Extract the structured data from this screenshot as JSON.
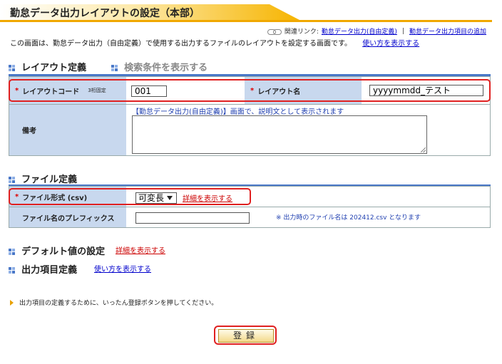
{
  "page": {
    "title": "勤怠データ出力レイアウトの設定（本部）",
    "related_label": "関連リンク:",
    "related_link_1": "勤怠データ出力(自由定義)",
    "separator": "|",
    "related_link_2": "勤怠データ出力項目の追加",
    "intro": "この画面は、勤怠データ出力（自由定義）で使用する出力するファイルのレイアウトを設定する画面です。",
    "howto_link": "使い方を表示する"
  },
  "layout_section": {
    "heading": "レイアウト定義",
    "toggle_search": "検索条件を表示する",
    "required_mark": "*",
    "code_label": "レイアウトコード",
    "code_hint": "3桁固定",
    "code_value": "001",
    "name_label": "レイアウト名",
    "name_value": "yyyymmdd_テスト",
    "note_label": "備考",
    "note_hint": "【勤怠データ出力(自由定義)】画面で、説明文として表示されます"
  },
  "file_section": {
    "heading": "ファイル定義",
    "format_label": "ファイル形式 (csv)",
    "format_value": "可変長",
    "format_detail_link": "詳細を表示する",
    "prefix_label": "ファイル名のプレフィックス",
    "prefix_value": "",
    "prefix_note": "※ 出力時のファイル名は  202412.csv  となります"
  },
  "default_section": {
    "heading": "デフォルト値の設定",
    "detail_link": "詳細を表示する"
  },
  "items_section": {
    "heading": "出力項目定義",
    "howto_link": "使い方を表示する",
    "notice": "出力項目の定義するために、いったん登録ボタンを押してください。"
  },
  "submit_label": "登録"
}
